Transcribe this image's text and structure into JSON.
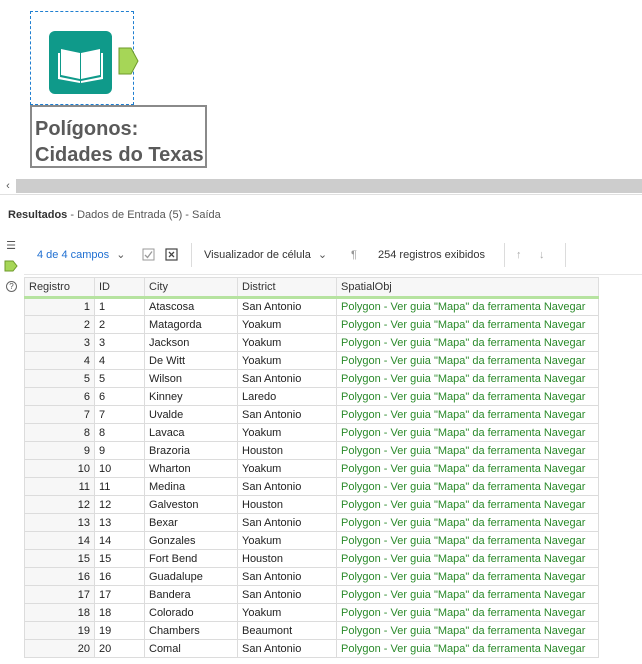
{
  "canvas": {
    "tool": {
      "label_line1": "Polígonos:",
      "label_line2": "Cidades do Texas",
      "icon": "book-icon",
      "color": "#0f9a8a"
    }
  },
  "results": {
    "title": "Resultados",
    "subtitle": " - Dados de Entrada (5) - Saída"
  },
  "toolbar": {
    "fields_label": "4 de 4 campos",
    "viewer_label": "Visualizador de célula",
    "records_label": "254 registros exibidos"
  },
  "grid": {
    "columns": [
      "Registro",
      "ID",
      "City",
      "District",
      "SpatialObj"
    ],
    "rows": [
      [
        "1",
        "1",
        "Atascosa",
        "San Antonio",
        "Polygon - Ver guia \"Mapa\" da ferramenta Navegar"
      ],
      [
        "2",
        "2",
        "Matagorda",
        "Yoakum",
        "Polygon - Ver guia \"Mapa\" da ferramenta Navegar"
      ],
      [
        "3",
        "3",
        "Jackson",
        "Yoakum",
        "Polygon - Ver guia \"Mapa\" da ferramenta Navegar"
      ],
      [
        "4",
        "4",
        "De Witt",
        "Yoakum",
        "Polygon - Ver guia \"Mapa\" da ferramenta Navegar"
      ],
      [
        "5",
        "5",
        "Wilson",
        "San Antonio",
        "Polygon - Ver guia \"Mapa\" da ferramenta Navegar"
      ],
      [
        "6",
        "6",
        "Kinney",
        "Laredo",
        "Polygon - Ver guia \"Mapa\" da ferramenta Navegar"
      ],
      [
        "7",
        "7",
        "Uvalde",
        "San Antonio",
        "Polygon - Ver guia \"Mapa\" da ferramenta Navegar"
      ],
      [
        "8",
        "8",
        "Lavaca",
        "Yoakum",
        "Polygon - Ver guia \"Mapa\" da ferramenta Navegar"
      ],
      [
        "9",
        "9",
        "Brazoria",
        "Houston",
        "Polygon - Ver guia \"Mapa\" da ferramenta Navegar"
      ],
      [
        "10",
        "10",
        "Wharton",
        "Yoakum",
        "Polygon - Ver guia \"Mapa\" da ferramenta Navegar"
      ],
      [
        "11",
        "11",
        "Medina",
        "San Antonio",
        "Polygon - Ver guia \"Mapa\" da ferramenta Navegar"
      ],
      [
        "12",
        "12",
        "Galveston",
        "Houston",
        "Polygon - Ver guia \"Mapa\" da ferramenta Navegar"
      ],
      [
        "13",
        "13",
        "Bexar",
        "San Antonio",
        "Polygon - Ver guia \"Mapa\" da ferramenta Navegar"
      ],
      [
        "14",
        "14",
        "Gonzales",
        "Yoakum",
        "Polygon - Ver guia \"Mapa\" da ferramenta Navegar"
      ],
      [
        "15",
        "15",
        "Fort Bend",
        "Houston",
        "Polygon - Ver guia \"Mapa\" da ferramenta Navegar"
      ],
      [
        "16",
        "16",
        "Guadalupe",
        "San Antonio",
        "Polygon - Ver guia \"Mapa\" da ferramenta Navegar"
      ],
      [
        "17",
        "17",
        "Bandera",
        "San Antonio",
        "Polygon - Ver guia \"Mapa\" da ferramenta Navegar"
      ],
      [
        "18",
        "18",
        "Colorado",
        "Yoakum",
        "Polygon - Ver guia \"Mapa\" da ferramenta Navegar"
      ],
      [
        "19",
        "19",
        "Chambers",
        "Beaumont",
        "Polygon - Ver guia \"Mapa\" da ferramenta Navegar"
      ],
      [
        "20",
        "20",
        "Comal",
        "San Antonio",
        "Polygon - Ver guia \"Mapa\" da ferramenta Navegar"
      ]
    ]
  }
}
